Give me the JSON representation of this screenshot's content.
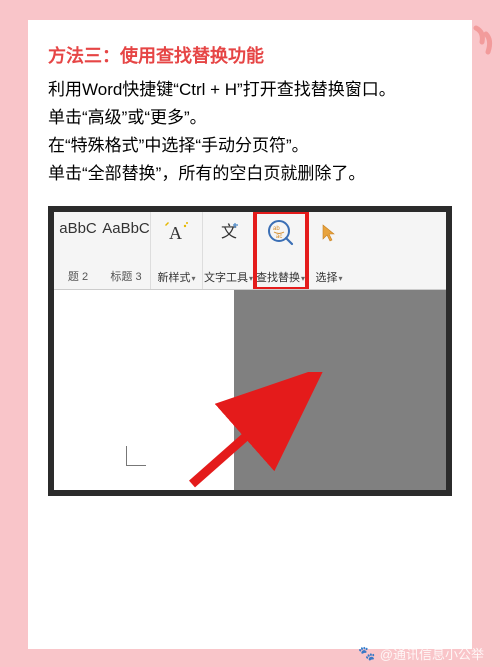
{
  "title": "方法三：使用查找替换功能",
  "paragraphs": [
    "利用Word快捷键“Ctrl + H”打开查找替换窗口。",
    "单击“高级”或“更多”。",
    "在“特殊格式”中选择“手动分页符”。",
    "单击“全部替换”，所有的空白页就删除了。"
  ],
  "ribbon": {
    "styles": [
      {
        "sample": "aBbC",
        "label": "题 2"
      },
      {
        "sample": "AaBbC",
        "label": "标题 3"
      }
    ],
    "buttons": [
      {
        "name": "new-style-button",
        "label": "新样式",
        "icon": "style-A"
      },
      {
        "name": "text-tools-button",
        "label": "文字工具",
        "icon": "text-tool"
      },
      {
        "name": "find-replace-button",
        "label": "查找替换",
        "icon": "find-replace",
        "highlight": true
      },
      {
        "name": "select-button",
        "label": "选择",
        "icon": "cursor"
      }
    ]
  },
  "watermark": "@通讯信息小公举"
}
